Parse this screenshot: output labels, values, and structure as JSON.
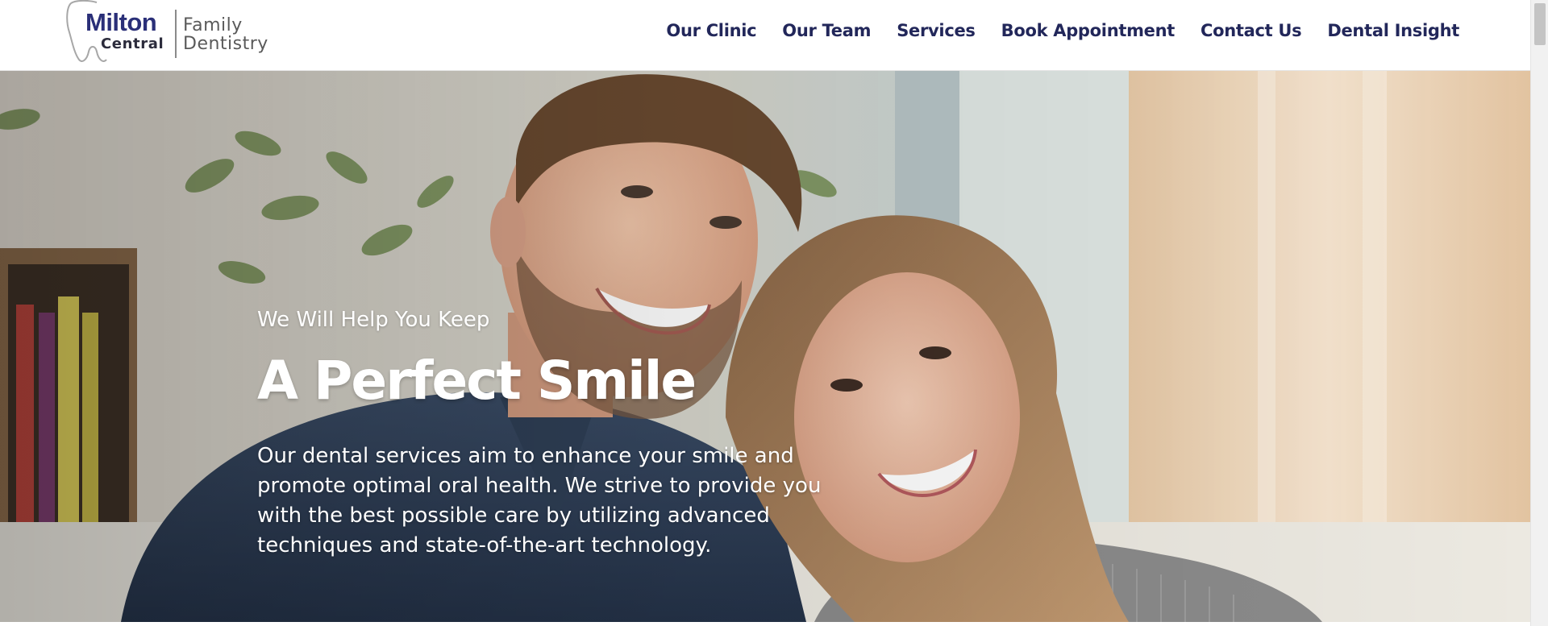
{
  "logo": {
    "name_top": "Milton",
    "name_bottom": "Central",
    "tag_top": "Family",
    "tag_bottom": "Dentistry"
  },
  "nav": {
    "items": [
      {
        "label": "Our Clinic"
      },
      {
        "label": "Our Team"
      },
      {
        "label": "Services"
      },
      {
        "label": "Book Appointment"
      },
      {
        "label": "Contact Us"
      },
      {
        "label": "Dental Insight"
      }
    ]
  },
  "hero": {
    "kicker": "We Will Help You Keep",
    "title": "A Perfect Smile",
    "description": "Our dental services aim to enhance your smile and promote optimal oral health. We strive to provide you with the best possible care by utilizing advanced techniques and state-of-the-art technology."
  },
  "colors": {
    "brand_navy": "#2a2f78",
    "nav_text": "#22275a",
    "logo_gray": "#5a5a5a",
    "hero_text": "#ffffff"
  },
  "icons": {
    "logo_mark": "tooth-outline-icon"
  }
}
